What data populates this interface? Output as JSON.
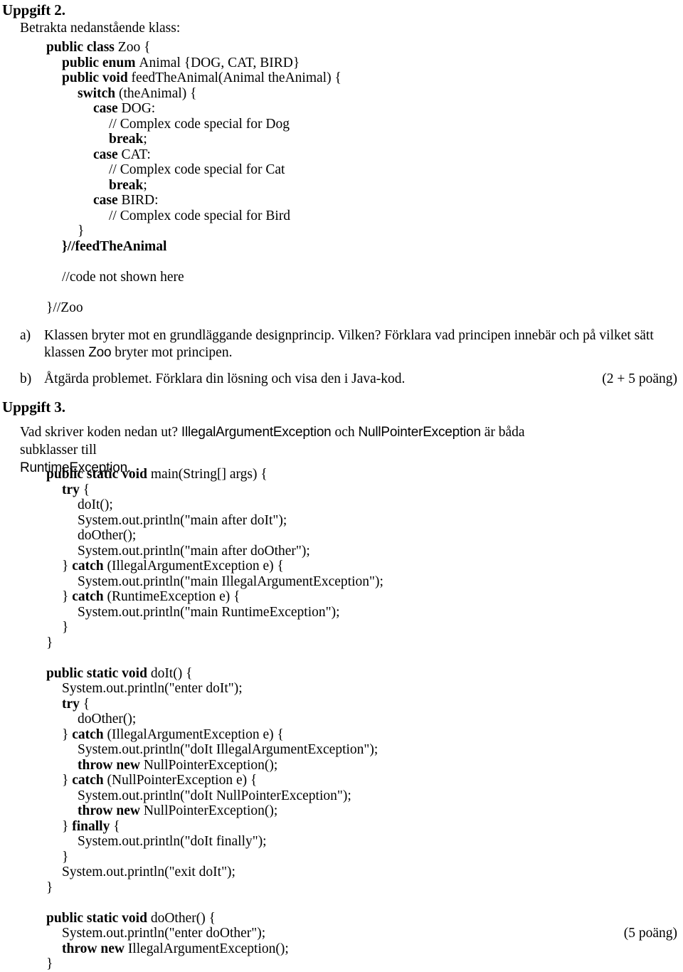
{
  "document": {
    "language": "sv",
    "exercises": [
      {
        "id": "uppgift-2",
        "heading": "Uppgift 2.",
        "intro": "Betrakta nedanstående klass:",
        "code_lines": [
          {
            "indent": 0,
            "parts": [
              {
                "t": "public class ",
                "bold": true
              },
              {
                "t": "Zoo {",
                "bold": false
              }
            ]
          },
          {
            "indent": 1,
            "parts": [
              {
                "t": "public enum ",
                "bold": true
              },
              {
                "t": "Animal {DOG, CAT, BIRD}",
                "bold": false
              }
            ]
          },
          {
            "indent": 1,
            "parts": [
              {
                "t": "public void ",
                "bold": true
              },
              {
                "t": "feedTheAnimal(Animal theAnimal) {",
                "bold": false
              }
            ]
          },
          {
            "indent": 2,
            "parts": [
              {
                "t": "switch ",
                "bold": true
              },
              {
                "t": "(theAnimal) {",
                "bold": false
              }
            ]
          },
          {
            "indent": 3,
            "parts": [
              {
                "t": "case ",
                "bold": true
              },
              {
                "t": "DOG:",
                "bold": false
              }
            ]
          },
          {
            "indent": 4,
            "parts": [
              {
                "t": "// Complex code special for Dog",
                "bold": false
              }
            ]
          },
          {
            "indent": 4,
            "parts": [
              {
                "t": "break",
                "bold": true
              },
              {
                "t": ";",
                "bold": false
              }
            ]
          },
          {
            "indent": 3,
            "parts": [
              {
                "t": "case ",
                "bold": true
              },
              {
                "t": "CAT:",
                "bold": false
              }
            ]
          },
          {
            "indent": 4,
            "parts": [
              {
                "t": "// Complex code special for Cat",
                "bold": false
              }
            ]
          },
          {
            "indent": 4,
            "parts": [
              {
                "t": "break",
                "bold": true
              },
              {
                "t": ";",
                "bold": false
              }
            ]
          },
          {
            "indent": 3,
            "parts": [
              {
                "t": "case ",
                "bold": true
              },
              {
                "t": "BIRD:",
                "bold": false
              }
            ]
          },
          {
            "indent": 4,
            "parts": [
              {
                "t": "// Complex code special for Bird",
                "bold": false
              }
            ]
          },
          {
            "indent": 2,
            "parts": [
              {
                "t": "}",
                "bold": false
              }
            ]
          },
          {
            "indent": 1,
            "parts": [
              {
                "t": "}//feedTheAnimal",
                "bold": true
              }
            ]
          },
          {
            "indent": -99,
            "parts": []
          },
          {
            "indent": 1,
            "parts": [
              {
                "t": "//code not shown here",
                "bold": false
              }
            ]
          },
          {
            "indent": -99,
            "parts": []
          },
          {
            "indent": 0,
            "parts": [
              {
                "t": "}//Zoo",
                "bold": false
              }
            ]
          }
        ],
        "items": [
          {
            "label": "a)",
            "line1_pre": "Klassen bryter mot en grundläggande designprincip. Vilken? Förklara vad principen innebär och på vilket sätt",
            "line2_pre": "klassen ",
            "line2_mono": "Zoo",
            "line2_post": " bryter mot principen.",
            "points": ""
          },
          {
            "label": "b)",
            "line1_pre": "Åtgärda problemet. Förklara din lösning och visa den i Java-kod.",
            "points": "(2 + 5 poäng)"
          }
        ]
      },
      {
        "id": "uppgift-3",
        "heading": "Uppgift 3.",
        "intro_line1_a": "Vad skriver koden nedan ut? ",
        "intro_line1_cls1": "IllegalArgumentException",
        "intro_line1_b": " och ",
        "intro_line1_cls2": "NullPointerException",
        "intro_line1_c": " är båda subklasser till",
        "intro_line2_cls": "RuntimeException",
        "intro_line2_after": ".",
        "points": "(5 poäng)",
        "code_lines": [
          {
            "indent": 0,
            "parts": [
              {
                "t": "public static void ",
                "bold": true
              },
              {
                "t": "main(String[] args) {",
                "bold": false
              }
            ]
          },
          {
            "indent": 1,
            "parts": [
              {
                "t": "try ",
                "bold": true
              },
              {
                "t": "{",
                "bold": false
              }
            ]
          },
          {
            "indent": 2,
            "parts": [
              {
                "t": "doIt();",
                "bold": false
              }
            ]
          },
          {
            "indent": 2,
            "parts": [
              {
                "t": "System.out.println(\"main after doIt\");",
                "bold": false
              }
            ]
          },
          {
            "indent": 2,
            "parts": [
              {
                "t": "doOther();",
                "bold": false
              }
            ]
          },
          {
            "indent": 2,
            "parts": [
              {
                "t": "System.out.println(\"main after doOther\");",
                "bold": false
              }
            ]
          },
          {
            "indent": 1,
            "parts": [
              {
                "t": "} ",
                "bold": false
              },
              {
                "t": "catch ",
                "bold": true
              },
              {
                "t": "(IllegalArgumentException e) {",
                "bold": false
              }
            ]
          },
          {
            "indent": 2,
            "parts": [
              {
                "t": "System.out.println(\"main IllegalArgumentException\");",
                "bold": false
              }
            ]
          },
          {
            "indent": 1,
            "parts": [
              {
                "t": "} ",
                "bold": false
              },
              {
                "t": "catch ",
                "bold": true
              },
              {
                "t": "(RuntimeException e) {",
                "bold": false
              }
            ]
          },
          {
            "indent": 2,
            "parts": [
              {
                "t": "System.out.println(\"main RuntimeException\");",
                "bold": false
              }
            ]
          },
          {
            "indent": 1,
            "parts": [
              {
                "t": "}",
                "bold": false
              }
            ]
          },
          {
            "indent": 0,
            "parts": [
              {
                "t": "}",
                "bold": false
              }
            ]
          },
          {
            "indent": -99,
            "parts": []
          },
          {
            "indent": 0,
            "parts": [
              {
                "t": "public static void ",
                "bold": true
              },
              {
                "t": "doIt() {",
                "bold": false
              }
            ]
          },
          {
            "indent": 1,
            "parts": [
              {
                "t": "System.out.println(\"enter doIt\");",
                "bold": false
              }
            ]
          },
          {
            "indent": 1,
            "parts": [
              {
                "t": "try ",
                "bold": true
              },
              {
                "t": "{",
                "bold": false
              }
            ]
          },
          {
            "indent": 2,
            "parts": [
              {
                "t": "doOther();",
                "bold": false
              }
            ]
          },
          {
            "indent": 1,
            "parts": [
              {
                "t": "} ",
                "bold": false
              },
              {
                "t": "catch ",
                "bold": true
              },
              {
                "t": "(IllegalArgumentException e) {",
                "bold": false
              }
            ]
          },
          {
            "indent": 2,
            "parts": [
              {
                "t": "System.out.println(\"doIt IllegalArgumentException\");",
                "bold": false
              }
            ]
          },
          {
            "indent": 2,
            "parts": [
              {
                "t": "throw new ",
                "bold": true
              },
              {
                "t": "NullPointerException();",
                "bold": false
              }
            ]
          },
          {
            "indent": 1,
            "parts": [
              {
                "t": "} ",
                "bold": false
              },
              {
                "t": "catch ",
                "bold": true
              },
              {
                "t": "(NullPointerException e) {",
                "bold": false
              }
            ]
          },
          {
            "indent": 2,
            "parts": [
              {
                "t": "System.out.println(\"doIt NullPointerException\");",
                "bold": false
              }
            ]
          },
          {
            "indent": 2,
            "parts": [
              {
                "t": "throw new ",
                "bold": true
              },
              {
                "t": "NullPointerException();",
                "bold": false
              }
            ]
          },
          {
            "indent": 1,
            "parts": [
              {
                "t": "} ",
                "bold": false
              },
              {
                "t": "finally ",
                "bold": true
              },
              {
                "t": "{",
                "bold": false
              }
            ]
          },
          {
            "indent": 2,
            "parts": [
              {
                "t": "System.out.println(\"doIt finally\");",
                "bold": false
              }
            ]
          },
          {
            "indent": 1,
            "parts": [
              {
                "t": "}",
                "bold": false
              }
            ]
          },
          {
            "indent": 1,
            "parts": [
              {
                "t": "System.out.println(\"exit doIt\");",
                "bold": false
              }
            ]
          },
          {
            "indent": 0,
            "parts": [
              {
                "t": "}",
                "bold": false
              }
            ]
          },
          {
            "indent": -99,
            "parts": []
          },
          {
            "indent": 0,
            "parts": [
              {
                "t": "public static void ",
                "bold": true
              },
              {
                "t": "doOther() {",
                "bold": false
              }
            ]
          },
          {
            "indent": 1,
            "parts": [
              {
                "t": "System.out.println(\"enter doOther\");",
                "bold": false
              }
            ]
          },
          {
            "indent": 1,
            "parts": [
              {
                "t": "throw new ",
                "bold": true
              },
              {
                "t": "IllegalArgumentException();",
                "bold": false
              }
            ]
          },
          {
            "indent": 0,
            "parts": [
              {
                "t": "}",
                "bold": false
              }
            ]
          }
        ]
      }
    ]
  }
}
